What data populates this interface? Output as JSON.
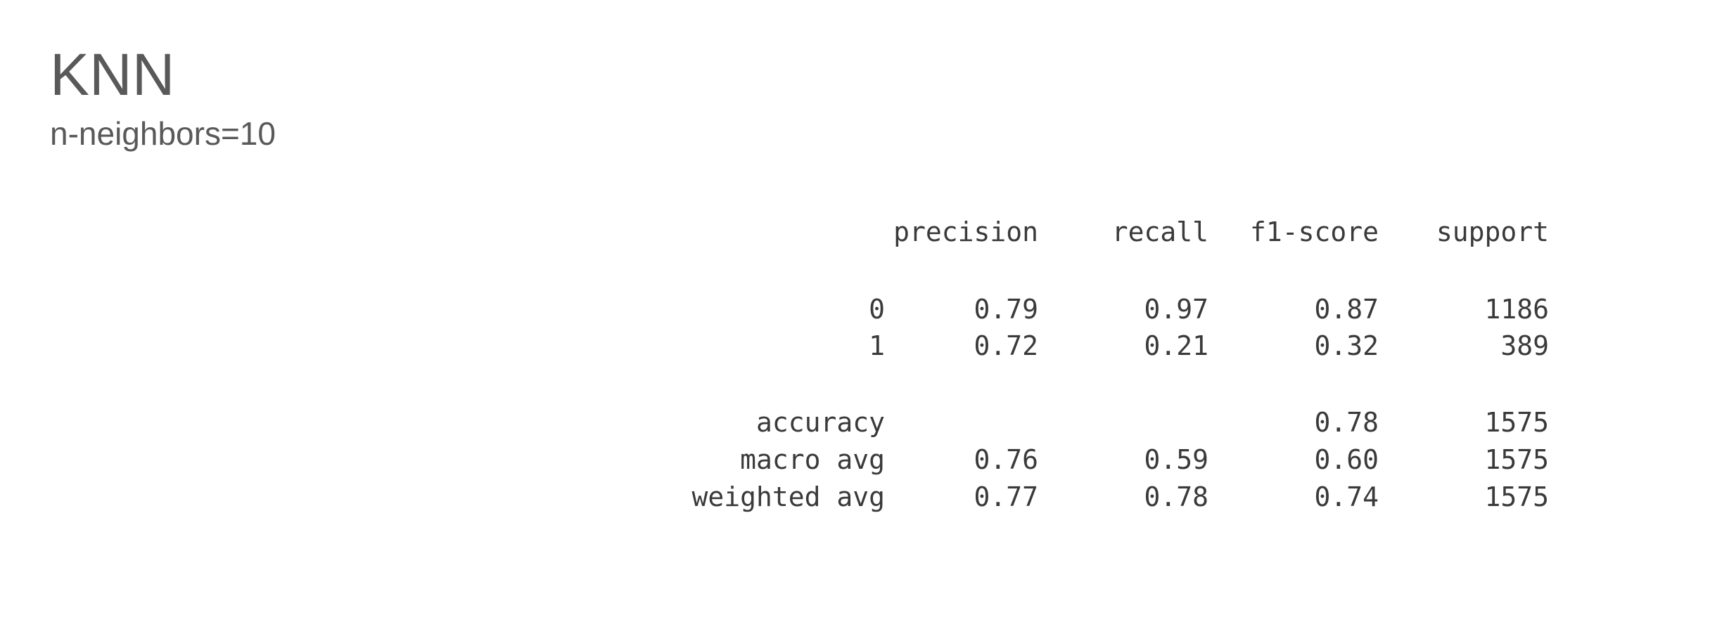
{
  "slide": {
    "title": "KNN",
    "subtitle": "n-neighbors=10"
  },
  "report": {
    "columns": [
      "precision",
      "recall",
      "f1-score",
      "support"
    ],
    "rows": [
      {
        "label": "0",
        "precision": "0.79",
        "recall": "0.97",
        "f1": "0.87",
        "support": "1186"
      },
      {
        "label": "1",
        "precision": "0.72",
        "recall": "0.21",
        "f1": "0.32",
        "support": "389"
      },
      {
        "label": "accuracy",
        "precision": "",
        "recall": "",
        "f1": "0.78",
        "support": "1575"
      },
      {
        "label": "macro avg",
        "precision": "0.76",
        "recall": "0.59",
        "f1": "0.60",
        "support": "1575"
      },
      {
        "label": "weighted avg",
        "precision": "0.77",
        "recall": "0.78",
        "f1": "0.74",
        "support": "1575"
      }
    ]
  }
}
